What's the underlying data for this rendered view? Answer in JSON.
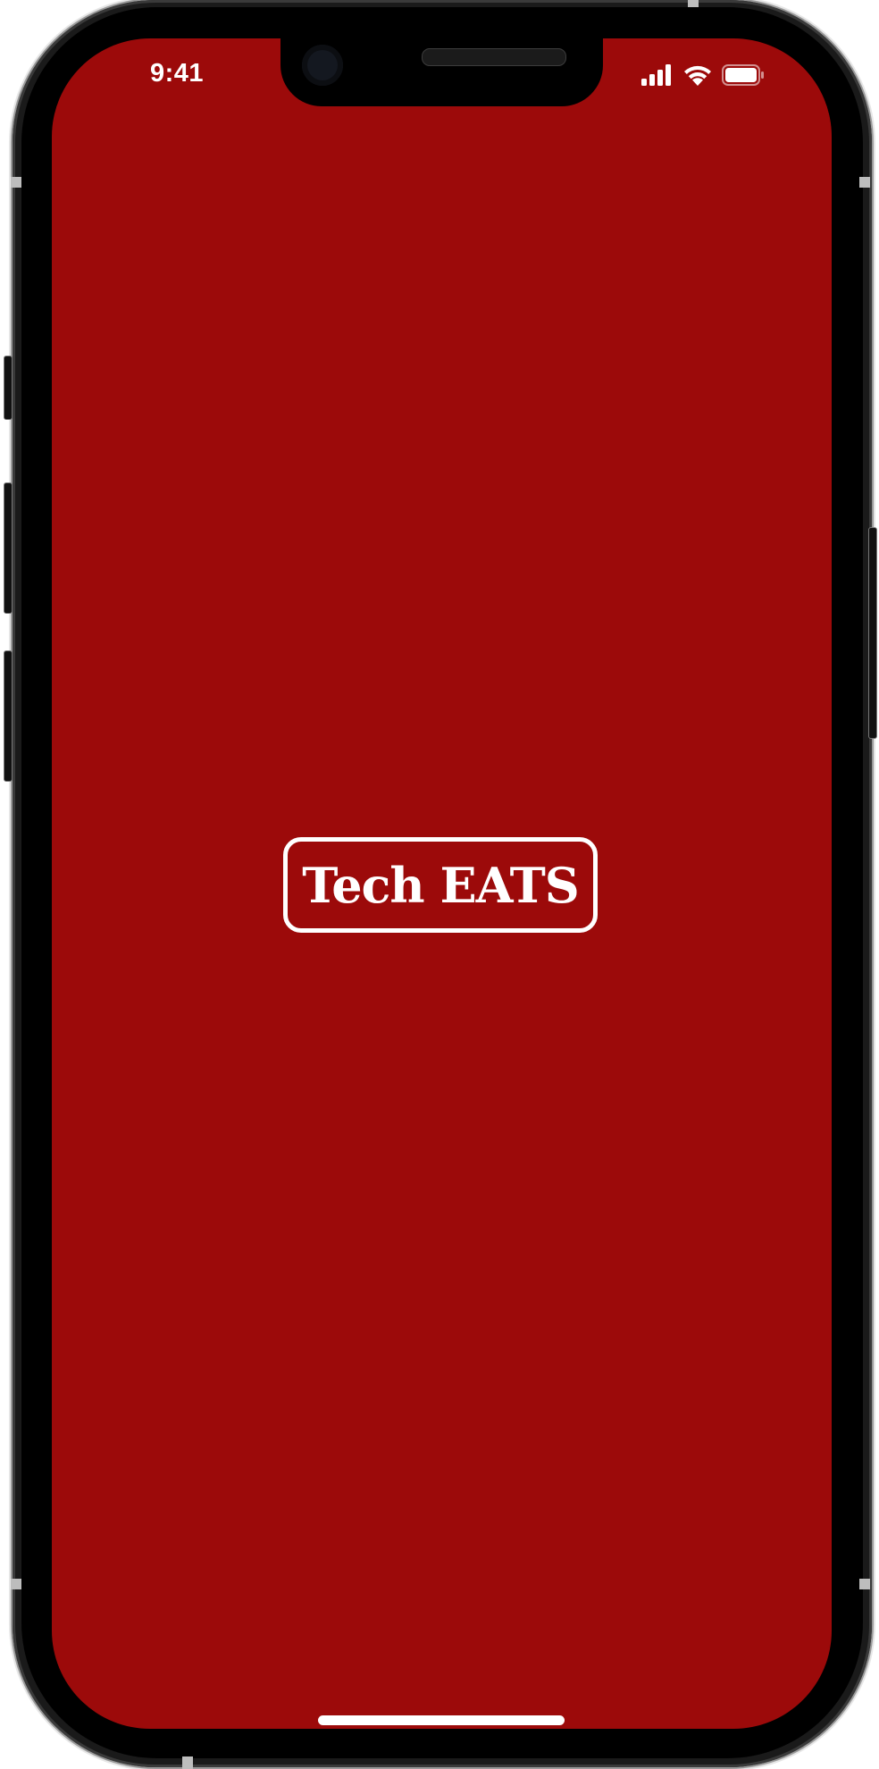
{
  "status_bar": {
    "time": "9:41",
    "signal_icon": "cellular-signal-icon",
    "wifi_icon": "wifi-icon",
    "battery_icon": "battery-full-icon"
  },
  "splash": {
    "logo_text": "Tech EATS",
    "background_color": "#9c0a0a",
    "text_color": "#ffffff"
  }
}
